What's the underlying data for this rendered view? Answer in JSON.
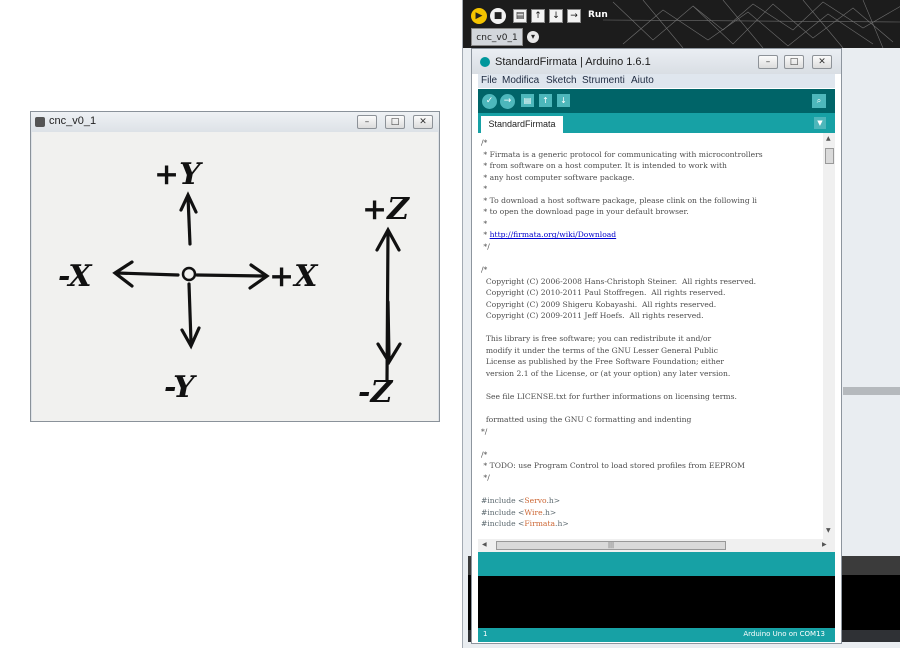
{
  "cnc_window": {
    "title": "cnc_v0_1",
    "drawing_labels": {
      "plus_y": "+Y",
      "minus_y": "-Y",
      "plus_x": "+X",
      "minus_x": "-X",
      "plus_z": "+Z",
      "minus_z": "-Z"
    }
  },
  "background_ide": {
    "run_label": "Run",
    "tab_label": "cnc_v0_1"
  },
  "arduino": {
    "title": "StandardFirmata | Arduino 1.6.1",
    "menu": [
      "File",
      "Modifica",
      "Sketch",
      "Strumenti",
      "Aiuto"
    ],
    "tab": "StandardFirmata",
    "code_lines": [
      "/*",
      " * Firmata is a generic protocol for communicating with microcontrollers",
      " * from software on a host computer. It is intended to work with",
      " * any host computer software package.",
      " *",
      " * To download a host software package, please clink on the following li",
      " * to open the download page in your default browser.",
      " *",
      " * ",
      " */",
      "",
      "/*",
      "  Copyright (C) 2006-2008 Hans-Christoph Steiner.  All rights reserved.",
      "  Copyright (C) 2010-2011 Paul Stoffregen.  All rights reserved.",
      "  Copyright (C) 2009 Shigeru Kobayashi.  All rights reserved.",
      "  Copyright (C) 2009-2011 Jeff Hoefs.  All rights reserved.",
      "",
      "  This library is free software; you can redistribute it and/or",
      "  modify it under the terms of the GNU Lesser General Public",
      "  License as published by the Free Software Foundation; either",
      "  version 2.1 of the License, or (at your option) any later version.",
      "",
      "  See file LICENSE.txt for further informations on licensing terms.",
      "",
      "  formatted using the GNU C formatting and indenting",
      "*/",
      "",
      "/*",
      " * TODO: use Program Control to load stored profiles from EEPROM",
      " */",
      "",
      "#include <Servo.h>",
      "#include <Wire.h>",
      "#include <Firmata.h>"
    ],
    "link_text": "http://firmata.org/wiki/Download",
    "include_prefix": "#include ",
    "includes": [
      "Servo",
      "Wire",
      "Firmata"
    ],
    "footer_line": "1",
    "footer_board": "Arduino Uno on COM13",
    "colors": {
      "teal_dark": "#006468",
      "teal": "#17a1a5",
      "teal_light": "#4db7bb"
    }
  }
}
